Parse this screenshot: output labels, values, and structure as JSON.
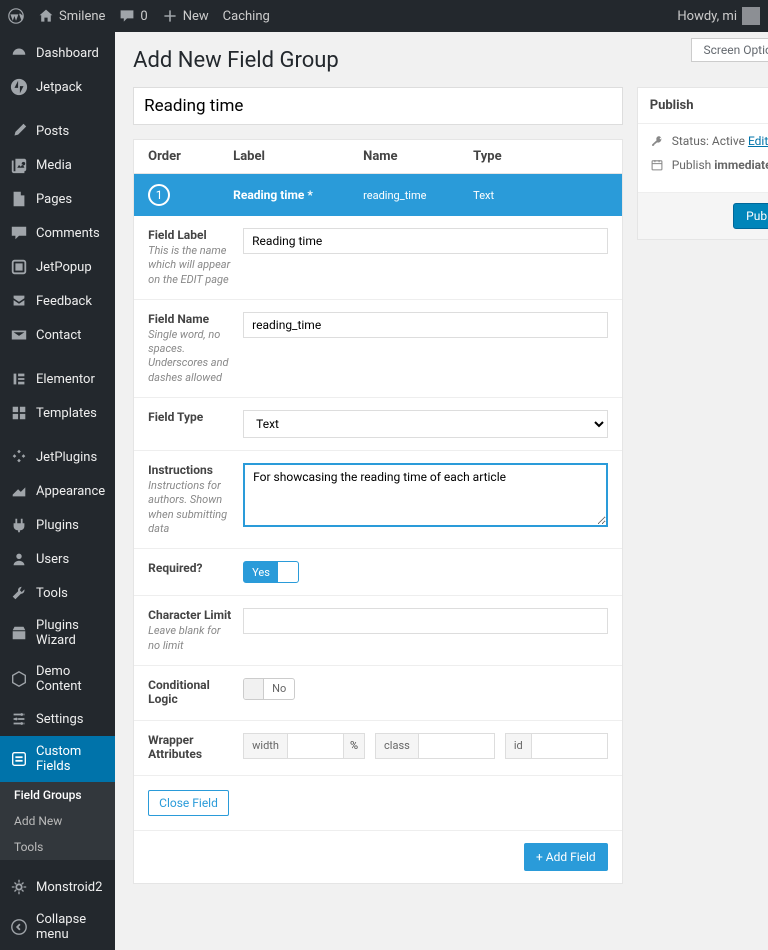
{
  "topbar": {
    "site": "Smilene",
    "comments": "0",
    "new": "New",
    "caching": "Caching",
    "howdy": "Howdy, mi"
  },
  "sidebar": {
    "items": [
      {
        "label": "Dashboard"
      },
      {
        "label": "Jetpack"
      },
      {
        "label": "Posts"
      },
      {
        "label": "Media"
      },
      {
        "label": "Pages"
      },
      {
        "label": "Comments"
      },
      {
        "label": "JetPopup"
      },
      {
        "label": "Feedback"
      },
      {
        "label": "Contact"
      },
      {
        "label": "Elementor"
      },
      {
        "label": "Templates"
      },
      {
        "label": "JetPlugins"
      },
      {
        "label": "Appearance"
      },
      {
        "label": "Plugins"
      },
      {
        "label": "Users"
      },
      {
        "label": "Tools"
      },
      {
        "label": "Plugins Wizard"
      },
      {
        "label": "Demo Content"
      },
      {
        "label": "Settings"
      },
      {
        "label": "Custom Fields"
      }
    ],
    "sub": [
      {
        "label": "Field Groups"
      },
      {
        "label": "Add New"
      },
      {
        "label": "Tools"
      }
    ],
    "monstroid": "Monstroid2",
    "collapse": "Collapse menu"
  },
  "screen_options": "Screen Options",
  "page_title": "Add New Field Group",
  "title_value": "Reading time",
  "headers": {
    "order": "Order",
    "label": "Label",
    "name": "Name",
    "type": "Type"
  },
  "field": {
    "num": "1",
    "label": "Reading time *",
    "name": "reading_time",
    "type": "Text"
  },
  "form": {
    "label": {
      "title": "Field Label",
      "help": "This is the name which will appear on the EDIT page",
      "value": "Reading time"
    },
    "name": {
      "title": "Field Name",
      "help": "Single word, no spaces. Underscores and dashes allowed",
      "value": "reading_time"
    },
    "type": {
      "title": "Field Type",
      "value": "Text"
    },
    "instr": {
      "title": "Instructions",
      "help": "Instructions for authors. Shown when submitting data",
      "value": "For showcasing the reading time of each article"
    },
    "required": {
      "title": "Required?",
      "yes": "Yes"
    },
    "charlimit": {
      "title": "Character Limit",
      "help": "Leave blank for no limit"
    },
    "condlogic": {
      "title": "Conditional Logic",
      "no": "No"
    },
    "wrapper": {
      "title": "Wrapper Attributes",
      "width": "width",
      "pct": "%",
      "class": "class",
      "id": "id"
    },
    "close": "Close Field",
    "add": "+ Add Field"
  },
  "publish": {
    "title": "Publish",
    "status": "Status: Active",
    "edit": "Edit",
    "schedule": "Publish",
    "immediately": "immediately",
    "button": "Publish"
  }
}
